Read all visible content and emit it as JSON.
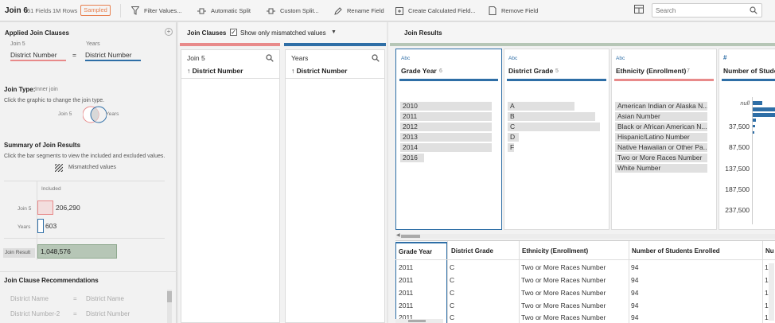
{
  "toolbar": {
    "title": "Join 6",
    "fields": "51 Fields",
    "rows": "1M Rows",
    "sampled": "Sampled",
    "buttons": [
      "Filter Values...",
      "Automatic Split",
      "Custom Split...",
      "Rename Field",
      "Create Calculated Field...",
      "Remove Field"
    ],
    "search_placeholder": "Search"
  },
  "left": {
    "applied_title": "Applied Join Clauses",
    "left_input": "Join 5",
    "right_input": "Years",
    "left_field": "District Number",
    "operator": "=",
    "right_field": "District Number",
    "join_type_label": "Join Type:",
    "join_type_value": "Inner join",
    "join_type_hint": "Click the graphic to change the join type.",
    "venn_left": "Join 5",
    "venn_right": "Years",
    "summary_title": "Summary of Join Results",
    "summary_hint": "Click the bar segments to view the included and excluded values.",
    "mismatched_legend": "Mismatched values",
    "included_label": "Included",
    "summary_rows": [
      {
        "label": "Join 5",
        "value": "206,290"
      },
      {
        "label": "Years",
        "value": "603"
      },
      {
        "label": "Join Result",
        "value": "1,048,576"
      }
    ],
    "recommendations_title": "Join Clause Recommendations",
    "recommendations": [
      {
        "left": "District Name",
        "op": "=",
        "right": "District Name"
      },
      {
        "left": "District Number-2",
        "op": "=",
        "right": "District Number"
      }
    ]
  },
  "mid": {
    "title": "Join Clauses",
    "checkbox_label": "Show only mismatched values",
    "columns": [
      {
        "name": "Join 5",
        "field": "↑ District Number"
      },
      {
        "name": "Years",
        "field": "↑ District Number"
      }
    ]
  },
  "right": {
    "title": "Join Results",
    "cards": [
      {
        "type": "Abc",
        "title": "Grade Year",
        "count": "6",
        "values": [
          "2010",
          "2011",
          "2012",
          "2013",
          "2014",
          "2016"
        ]
      },
      {
        "type": "Abc",
        "title": "District Grade",
        "count": "5",
        "values": [
          "A",
          "B",
          "C",
          "D",
          "F"
        ]
      },
      {
        "type": "Abc",
        "title": "Ethnicity (Enrollment)",
        "count": "7",
        "values": [
          "American Indian or Alaska N...",
          "Asian Number",
          "Black or African American N...",
          "Hispanic/Latino Number",
          "Native Hawaiian or Other Pa...",
          "Two or More Races Number",
          "White Number"
        ]
      },
      {
        "type": "#",
        "title": "Number of Students Enrolled",
        "axis": [
          "null",
          "37,500",
          "87,500",
          "137,500",
          "187,500",
          "237,500"
        ]
      }
    ],
    "grid_headers": [
      "Grade Year",
      "District Grade",
      "Ethnicity (Enrollment)",
      "Number of Students Enrolled",
      "Nu"
    ],
    "grid_rows": [
      [
        "2011",
        "C",
        "Two or More Races Number",
        "94",
        "1"
      ],
      [
        "2011",
        "C",
        "Two or More Races Number",
        "94",
        "1"
      ],
      [
        "2011",
        "C",
        "Two or More Races Number",
        "94",
        "1"
      ],
      [
        "2011",
        "C",
        "Two or More Races Number",
        "94",
        "1"
      ],
      [
        "2011",
        "C",
        "Two or More Races Number",
        "94",
        "1"
      ]
    ]
  },
  "colors": {
    "join5": "#e88a8a",
    "years": "#2e6ea6",
    "result": "#b6c6b6",
    "accent": "#e8804f"
  }
}
